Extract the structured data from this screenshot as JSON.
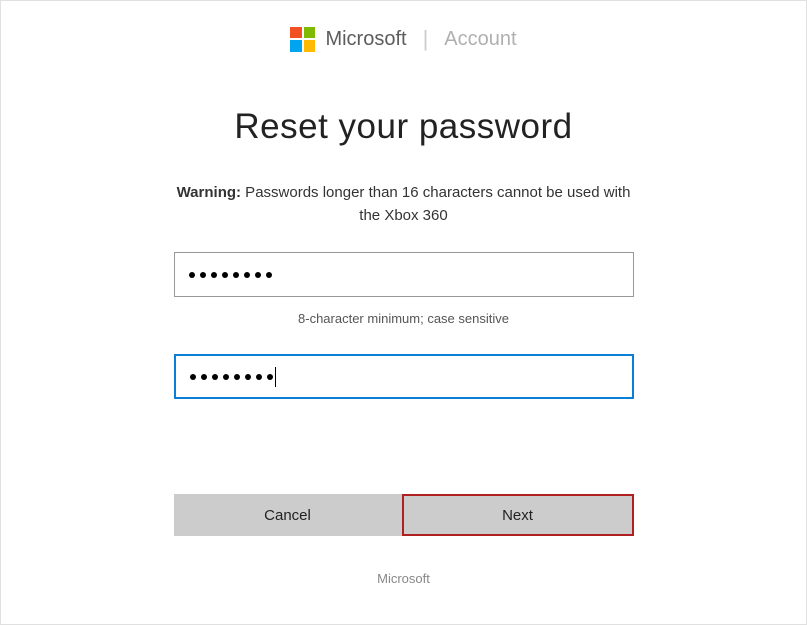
{
  "header": {
    "brand": "Microsoft",
    "section": "Account"
  },
  "main": {
    "title": "Reset your password",
    "warning_label": "Warning:",
    "warning_text": " Passwords longer than 16 characters cannot be used with the Xbox 360",
    "password1": {
      "value": "••••••••",
      "dot_count": 8
    },
    "hint": "8-character minimum; case sensitive",
    "password2": {
      "value": "••••••••",
      "dot_count": 8,
      "focused": true
    },
    "buttons": {
      "cancel": "Cancel",
      "next": "Next"
    }
  },
  "footer": {
    "text": "Microsoft"
  }
}
